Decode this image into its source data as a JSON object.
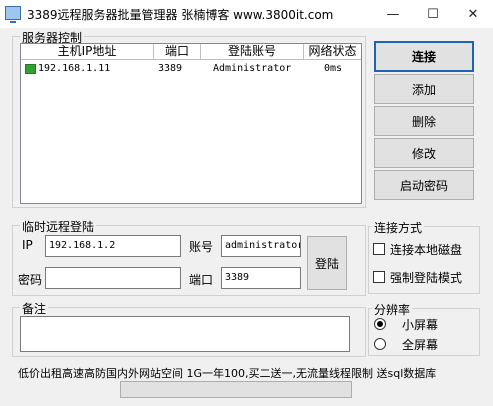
{
  "window": {
    "title": "3389远程服务器批量管理器 张楠博客 www.3800it.com",
    "minimize_glyph": "—",
    "maximize_glyph": "☐",
    "close_glyph": "✕"
  },
  "server_control": {
    "legend": "服务器控制",
    "columns": [
      "主机IP地址",
      "端口",
      "登陆账号",
      "网络状态"
    ],
    "rows": [
      {
        "ip": "192.168.1.11",
        "port": "3389",
        "account": "Administrator",
        "status": "0ms",
        "icon": "monitor-icon"
      }
    ]
  },
  "actions": {
    "connect": "连接",
    "add": "添加",
    "delete": "删除",
    "edit": "修改",
    "startup_password": "启动密码"
  },
  "temp_login": {
    "legend": "临时远程登陆",
    "ip_label": "IP",
    "ip_value": "192.168.1.2",
    "account_label": "账号",
    "account_value": "administrator",
    "password_label": "密码",
    "password_value": "",
    "port_label": "端口",
    "port_value": "3389",
    "login_button": "登陆"
  },
  "connect_mode": {
    "legend": "连接方式",
    "local_disk": "连接本地磁盘",
    "force_login": "强制登陆模式",
    "local_disk_checked": false,
    "force_login_checked": false
  },
  "notes": {
    "legend": "备注",
    "value": ""
  },
  "resolution": {
    "legend": "分辨率",
    "small": "小屏幕",
    "full": "全屏幕",
    "selected": "small"
  },
  "footer": {
    "ad_text": "低价出租高速高防国内外网站空间 1G一年100,买二送一,无流量线程限制 送sql数据库",
    "button_label": ""
  },
  "colors": {
    "accent": "#1e64b4",
    "monitor_icon": "#2fa12f"
  }
}
